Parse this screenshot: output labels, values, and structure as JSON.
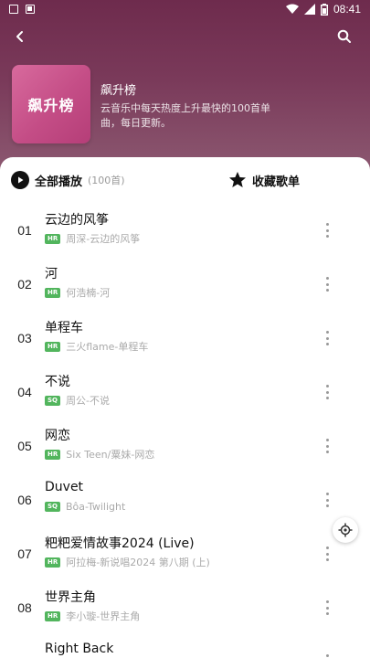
{
  "status_bar": {
    "time": "08:41",
    "icons": [
      "image-icon",
      "notification-icon",
      "wifi-icon",
      "signal-icon",
      "battery-icon"
    ]
  },
  "nav": {
    "back_icon": "chevron-left-icon",
    "search_icon": "search-icon"
  },
  "playlist": {
    "cover_text": "飙升榜",
    "title": "飙升榜",
    "description": "云音乐中每天热度上升最快的100首单曲，每日更新。"
  },
  "actions": {
    "play_all": "全部播放",
    "play_count": "(100首)",
    "collect": "收藏歌单"
  },
  "songs": [
    {
      "index": "01",
      "title": "云边的风筝",
      "badge": "HR",
      "artist": "周深-云边的风筝"
    },
    {
      "index": "02",
      "title": "河",
      "badge": "HR",
      "artist": "何浩楠-河"
    },
    {
      "index": "03",
      "title": "单程车",
      "badge": "HR",
      "artist": "三火flame-单程车"
    },
    {
      "index": "04",
      "title": "不说",
      "badge": "SQ",
      "artist": "周公-不说"
    },
    {
      "index": "05",
      "title": "网恋",
      "badge": "HR",
      "artist": "Six Teen/粟妹-网恋"
    },
    {
      "index": "06",
      "title": "Duvet",
      "badge": "SQ",
      "artist": "Bôa-Twilight"
    },
    {
      "index": "07",
      "title": "粑粑爱情故事2024 (Live)",
      "badge": "HR",
      "artist": "阿拉梅-新说唱2024 第八期 (上)"
    },
    {
      "index": "08",
      "title": "世界主角",
      "badge": "HR",
      "artist": "李小璇-世界主角"
    },
    {
      "index": "",
      "title": "Right Back",
      "badge": "",
      "artist": ""
    }
  ],
  "colors": {
    "header_top": "#6e2b4d",
    "header_bottom": "#8d5a72",
    "cover": "#c44d86",
    "badge": "#52b55d"
  }
}
